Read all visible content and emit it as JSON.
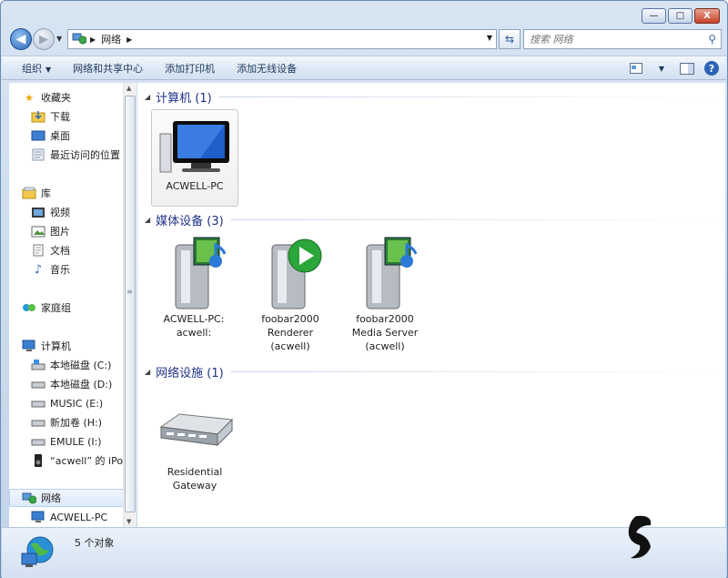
{
  "window": {
    "caption_buttons": {
      "minimize": "—",
      "maximize": "□",
      "close": "X"
    }
  },
  "address": {
    "segments": [
      "网络"
    ],
    "search_placeholder": "搜索 网络"
  },
  "toolbar": {
    "organize": "组织",
    "network_center": "网络和共享中心",
    "add_printer": "添加打印机",
    "add_wireless": "添加无线设备"
  },
  "nav": {
    "favorites": "收藏夹",
    "downloads": "下载",
    "desktop": "桌面",
    "recent": "最近访问的位置",
    "libraries": "库",
    "videos": "视频",
    "pictures": "图片",
    "documents": "文档",
    "music": "音乐",
    "homegroup": "家庭组",
    "computer": "计算机",
    "drives": [
      "本地磁盘 (C:)",
      "本地磁盘 (D:)",
      "MUSIC (E:)",
      "新加卷 (H:)",
      "EMULE (I:)",
      "“acwell” 的 iPo"
    ],
    "network": "网络",
    "network_child": "ACWELL-PC"
  },
  "groups": {
    "computers": {
      "title": "计算机 (1)",
      "items": [
        "ACWELL-PC"
      ]
    },
    "media": {
      "title": "媒体设备 (3)",
      "items": [
        [
          "ACWELL-PC:",
          "acwell:"
        ],
        [
          "foobar2000",
          "Renderer",
          "(acwell)"
        ],
        [
          "foobar2000",
          "Media Server",
          "(acwell)"
        ]
      ]
    },
    "infra": {
      "title": "网络设施 (1)",
      "items": [
        [
          "Residential",
          "Gateway"
        ]
      ]
    }
  },
  "status": {
    "count": "5 个对象"
  },
  "colors": {
    "group_title": "#1e3287",
    "accent": "#2b62b6"
  }
}
